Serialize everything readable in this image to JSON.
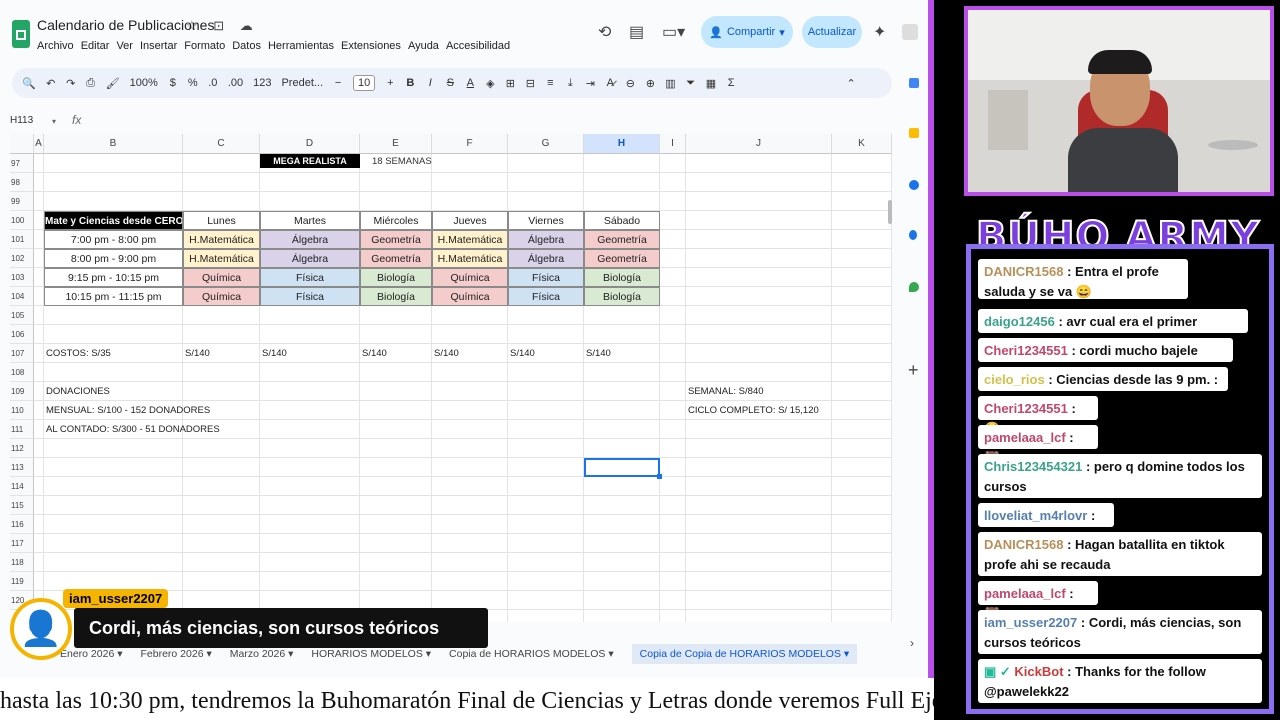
{
  "sheets": {
    "doc_title": "Calendario de Publicaciones",
    "menu": [
      "Archivo",
      "Editar",
      "Ver",
      "Insertar",
      "Formato",
      "Datos",
      "Herramientas",
      "Extensiones",
      "Ayuda",
      "Accesibilidad"
    ],
    "share_label": "Compartir",
    "update_label": "Actualizar",
    "toolbar": {
      "zoom": "100%",
      "currency": "$",
      "percent": "%",
      "dec_less": ".0",
      "dec_more": ".00",
      "num123": "123",
      "font": "Predet...",
      "font_size": "10"
    },
    "name_box": "H113",
    "columns": [
      "A",
      "B",
      "C",
      "D",
      "E",
      "F",
      "G",
      "H",
      "I",
      "J",
      "K"
    ],
    "rows": [
      "97",
      "98",
      "99",
      "100",
      "101",
      "102",
      "103",
      "104",
      "105",
      "106",
      "107",
      "108",
      "109",
      "110",
      "111",
      "112",
      "113",
      "114",
      "115",
      "116",
      "117",
      "118",
      "119",
      "120"
    ],
    "tag_mega": "MEGA REALISTA",
    "tag_semanas": "18 SEMANAS",
    "schedule": {
      "header": [
        "Mate y Ciencias desde CERO",
        "Lunes",
        "Martes",
        "Miércoles",
        "Jueves",
        "Viernes",
        "Sábado"
      ],
      "rows": [
        [
          "7:00 pm - 8:00 pm",
          "H.Matemática",
          "Álgebra",
          "Geometría",
          "H.Matemática",
          "Álgebra",
          "Geometría"
        ],
        [
          "8:00 pm - 9:00 pm",
          "H.Matemática",
          "Álgebra",
          "Geometría",
          "H.Matemática",
          "Álgebra",
          "Geometría"
        ],
        [
          "9:15 pm - 10:15 pm",
          "Química",
          "Física",
          "Biología",
          "Química",
          "Física",
          "Biología"
        ],
        [
          "10:15 pm - 11:15 pm",
          "Química",
          "Física",
          "Biología",
          "Química",
          "Física",
          "Biología"
        ]
      ]
    },
    "costs": [
      "COSTOS: S/35",
      "S/140",
      "S/140",
      "S/140",
      "S/140",
      "S/140",
      "S/140"
    ],
    "donaciones": "DONACIONES",
    "mensual": "MENSUAL: S/100 -  152 DONADORES",
    "contado": "AL CONTADO: S/300 -  51 DONADORES",
    "semanal": "SEMANAL: S/840",
    "ciclo": "CICLO COMPLETO: S/ 15,120",
    "tabs": [
      "Enero 2026",
      "Febrero 2026",
      "Marzo 2026",
      "HORARIOS MODELOS",
      "Copia de HORARIOS MODELOS",
      "Copia de Copia de HORARIOS MODELOS"
    ],
    "colors": {
      "yellow": "#fff2cc",
      "purple": "#d9d2e9",
      "red": "#f4cccc",
      "blue": "#cfe2f3",
      "green": "#d9ead3"
    }
  },
  "overlay": {
    "username": "iam_usser2207",
    "message": "Cordi, más ciencias, son cursos teóricos"
  },
  "ticker": "hasta las 10:30 pm, tendremos la Buhomaratón Final de Ciencias y Letras donde veremos Full Eje",
  "chat": {
    "title": "BÚHO ARMY",
    "messages": [
      {
        "user": "DANICR1568",
        "text": ": Entra el profe saluda y se va 😄"
      },
      {
        "user": "daigo12456",
        "text": ": avr cual era el primer horario"
      },
      {
        "user": "Cheri1234551",
        "text": ": cordi mucho bajele mas"
      },
      {
        "user": "cielo_rios",
        "text": ": Ciencias desde las 9 pm. :("
      },
      {
        "user": "Cheri1234551",
        "text": ": 😭"
      },
      {
        "user": "pamelaaa_lcf",
        "text": ": 🐻"
      },
      {
        "user": "Chris123454321",
        "text": ": pero q domine todos los cursos"
      },
      {
        "user": "lloveliat_m4rlovr",
        "text": ": XD"
      },
      {
        "user": "DANICR1568",
        "text": ": Hagan batallita en tiktok profe ahi se recauda"
      },
      {
        "user": "pamelaaa_lcf",
        "text": ": 🐻"
      },
      {
        "user": "iam_usser2207",
        "text": ": Cordi, más ciencias, son cursos teóricos"
      },
      {
        "user": "KickBot",
        "text": ": Thanks for the follow @pawelekk22"
      }
    ]
  }
}
